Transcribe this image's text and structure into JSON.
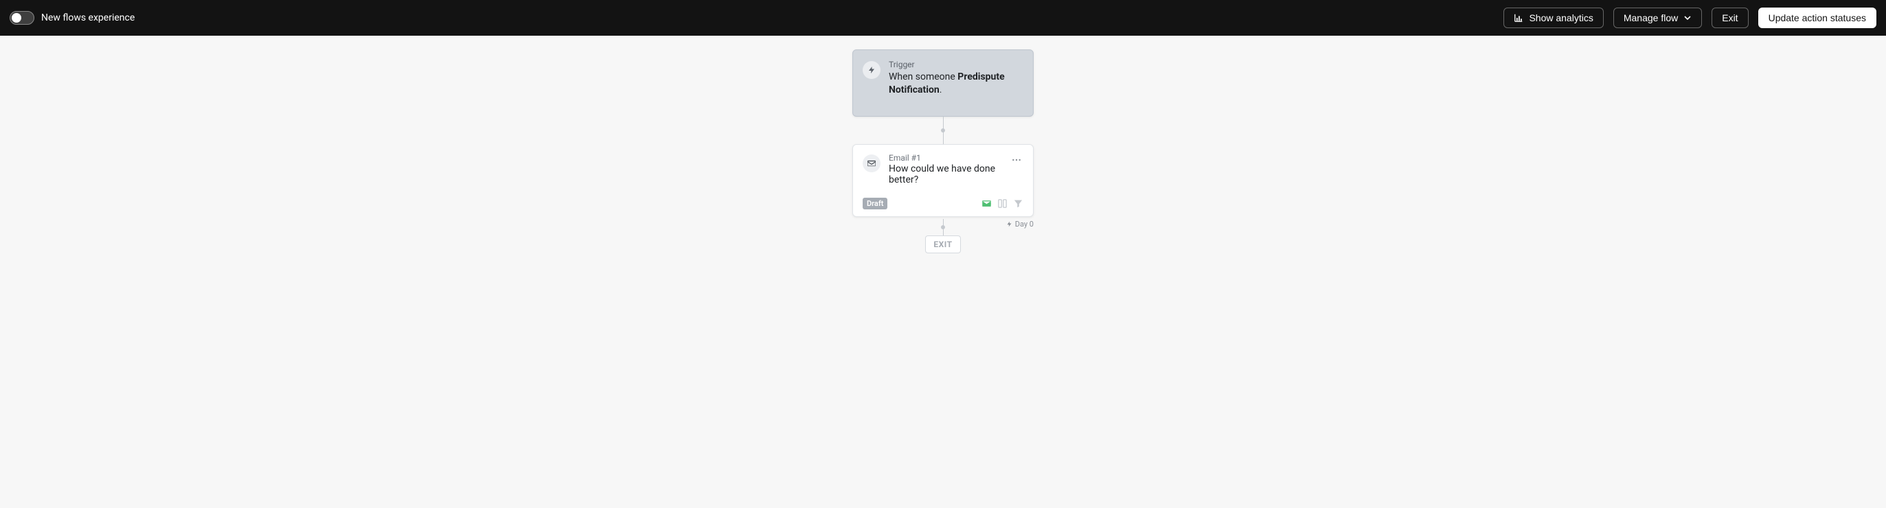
{
  "header": {
    "toggle_label": "New flows experience",
    "show_analytics": "Show analytics",
    "manage_flow": "Manage flow",
    "exit": "Exit",
    "update_statuses": "Update action statuses"
  },
  "flow": {
    "trigger": {
      "label": "Trigger",
      "prefix": "When someone ",
      "bold": "Predispute Notification",
      "suffix": "."
    },
    "email": {
      "label": "Email #1",
      "title": "How could we have done better?",
      "badge": "Draft"
    },
    "day_label": "Day 0",
    "exit_node": "EXIT"
  }
}
